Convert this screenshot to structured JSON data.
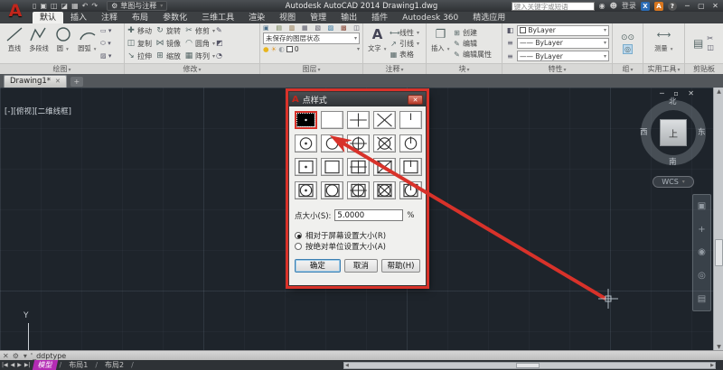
{
  "titlebar": {
    "workspace": "草图与注释",
    "title": "Autodesk AutoCAD 2014   Drawing1.dwg",
    "search_placeholder": "键入关键字或短语",
    "signin": "登录",
    "help": "?"
  },
  "ribbon": {
    "tabs": [
      {
        "label": "默认",
        "active": true
      },
      {
        "label": "插入",
        "active": false
      },
      {
        "label": "注释",
        "active": false
      },
      {
        "label": "布局",
        "active": false
      },
      {
        "label": "参数化",
        "active": false
      },
      {
        "label": "三维工具",
        "active": false
      },
      {
        "label": "渲染",
        "active": false
      },
      {
        "label": "视图",
        "active": false
      },
      {
        "label": "管理",
        "active": false
      },
      {
        "label": "输出",
        "active": false
      },
      {
        "label": "插件",
        "active": false
      },
      {
        "label": "Autodesk 360",
        "active": false
      },
      {
        "label": "精选应用",
        "active": false
      }
    ],
    "draw": {
      "label": "绘图",
      "tools": [
        {
          "name": "line",
          "label": "直线"
        },
        {
          "name": "polyline",
          "label": "多段线"
        },
        {
          "name": "circle",
          "label": "圆"
        },
        {
          "name": "arc",
          "label": "圆弧"
        }
      ]
    },
    "modify": {
      "label": "修改",
      "tools": [
        {
          "name": "move",
          "label": "移动"
        },
        {
          "name": "rotate",
          "label": "旋转"
        },
        {
          "name": "trim",
          "label": "修剪"
        },
        {
          "name": "copy",
          "label": "复制"
        },
        {
          "name": "mirror",
          "label": "镜像"
        },
        {
          "name": "fillet",
          "label": "圆角"
        },
        {
          "name": "stretch",
          "label": "拉伸"
        },
        {
          "name": "scale",
          "label": "缩放"
        },
        {
          "name": "array",
          "label": "阵列"
        }
      ]
    },
    "layers": {
      "label": "图层",
      "state": "未保存的图层状态",
      "current_layer": "0"
    },
    "annotate": {
      "label": "注释",
      "text": "文字",
      "rows": [
        "线性",
        "引线",
        "表格"
      ]
    },
    "block": {
      "label": "块",
      "insert": "插入",
      "rows": [
        "创建",
        "编辑",
        "编辑属性"
      ]
    },
    "props": {
      "label": "特性",
      "rows": [
        "ByLayer",
        "ByLayer",
        "ByLayer"
      ]
    },
    "groups": {
      "label": "组"
    },
    "utils": {
      "label": "实用工具",
      "measure": "测量"
    },
    "clipboard": {
      "label": "剪贴板"
    }
  },
  "filetab": {
    "name": "Drawing1*"
  },
  "canvas": {
    "viewport": "[-][俯视][二维线框]",
    "viewcube": {
      "n": "北",
      "s": "南",
      "e": "东",
      "w": "西",
      "top": "上",
      "wcs": "WCS"
    },
    "ucs_y": "Y"
  },
  "dialog": {
    "title": "点样式",
    "styles": [
      "dot",
      "blank",
      "plus",
      "cross",
      "tick",
      "circle-dot",
      "circle-blank",
      "circle-plus",
      "circle-cross",
      "circle-tick",
      "square-dot",
      "square-blank",
      "square-plus",
      "square-cross",
      "square-tick",
      "square-circle-dot",
      "square-circle-blank",
      "square-circle-plus",
      "square-circle-cross",
      "square-circle-tick"
    ],
    "selected_index": 0,
    "size_label": "点大小(S):",
    "size_value": "5.0000",
    "unit": "%",
    "radios": [
      {
        "label": "相对于屏幕设置大小(R)",
        "checked": true
      },
      {
        "label": "按绝对单位设置大小(A)",
        "checked": false
      }
    ],
    "buttons": {
      "ok": "确定",
      "cancel": "取消",
      "help": "帮助(H)"
    }
  },
  "cmd": {
    "text": "'_ddptype"
  },
  "layoutbar": {
    "model": "模型",
    "layouts": [
      "布局1",
      "布局2"
    ]
  },
  "colors": {
    "annotation": "#d8322a",
    "model_tab": "#b42cb4",
    "bylayer_white": "#ffffff"
  }
}
